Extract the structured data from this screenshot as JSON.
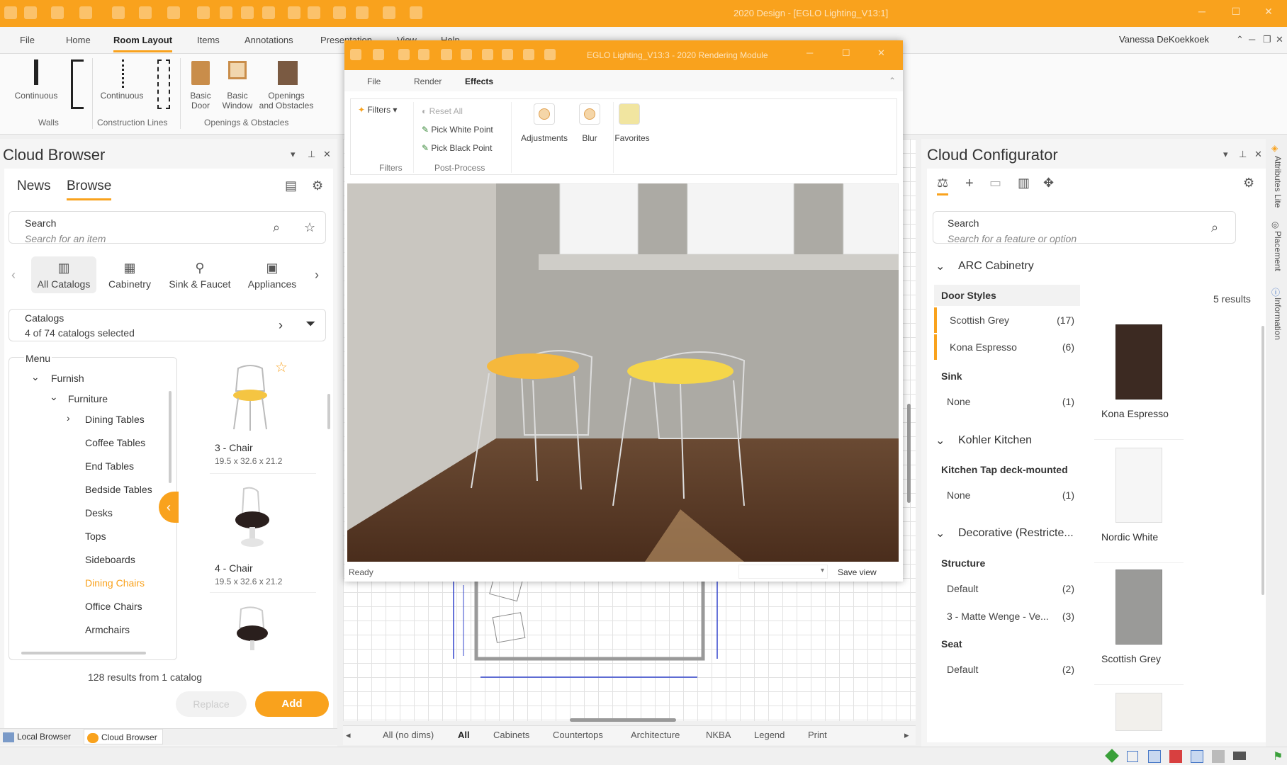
{
  "app": {
    "title": "2020 Design - [EGLO Lighting_V13:1]",
    "user": "Vanessa DeKoekkoek"
  },
  "ribbon_tabs": [
    "File",
    "Home",
    "Room Layout",
    "Items",
    "Annotations",
    "Presentation",
    "View",
    "Help"
  ],
  "ribbon": {
    "walls_continuous": "Continuous",
    "walls_group": "Walls",
    "cl_continuous": "Continuous",
    "cl_group": "Construction Lines",
    "basic_door_1": "Basic",
    "basic_door_2": "Door",
    "basic_window_1": "Basic",
    "basic_window_2": "Window",
    "openings_1": "Openings",
    "openings_2": "and Obstacles",
    "oo_group": "Openings & Obstacles"
  },
  "cloud_browser": {
    "title": "Cloud Browser",
    "tab_news": "News",
    "tab_browse": "Browse",
    "search_label": "Search",
    "search_placeholder": "Search for an item",
    "categories": [
      "All Catalogs",
      "Cabinetry",
      "Sink & Faucet",
      "Appliances"
    ],
    "catalogs_label": "Catalogs",
    "catalogs_value": "4 of 74 catalogs selected",
    "menu_label": "Menu",
    "menu": {
      "furnish": "Furnish",
      "furniture": "Furniture",
      "dining_tables": "Dining Tables",
      "coffee_tables": "Coffee Tables",
      "end_tables": "End Tables",
      "bedside_tables": "Bedside Tables",
      "desks": "Desks",
      "tops": "Tops",
      "sideboards": "Sideboards",
      "dining_chairs": "Dining Chairs",
      "office_chairs": "Office Chairs",
      "armchairs": "Armchairs"
    },
    "products": [
      {
        "name": "3 - Chair",
        "dims": "19.5 x 32.6 x 21.2"
      },
      {
        "name": "4 - Chair",
        "dims": "19.5 x 32.6 x 21.2"
      }
    ],
    "results": "128 results from 1 catalog",
    "replace_label": "Replace",
    "add_label": "Add",
    "bottom_local": "Local Browser",
    "bottom_cloud": "Cloud Browser"
  },
  "render_module": {
    "title": "EGLO Lighting_V13:3 - 2020 Rendering Module",
    "tabs": [
      "File",
      "Render",
      "Effects"
    ],
    "filters": "Filters",
    "reset_all": "Reset All",
    "pick_white": "Pick White Point",
    "pick_black": "Pick Black Point",
    "adjustments": "Adjustments",
    "blur": "Blur",
    "favorites": "Favorites",
    "grp_filters": "Filters",
    "grp_postprocess": "Post-Process",
    "status": "Ready",
    "save_view": "Save view"
  },
  "bottom_tabs": [
    "All (no dims)",
    "All",
    "Cabinets",
    "Countertops",
    "Architecture",
    "NKBA",
    "Legend",
    "Print"
  ],
  "cloud_configurator": {
    "title": "Cloud Configurator",
    "search_label": "Search",
    "search_placeholder": "Search for a feature or option",
    "results": "5 results",
    "arc": "ARC Cabinetry",
    "door_styles": "Door Styles",
    "scottish_grey": "Scottish Grey",
    "scottish_grey_count": "(17)",
    "kona_espresso": "Kona Espresso",
    "kona_espresso_count": "(6)",
    "sink": "Sink",
    "none": "None",
    "one": "(1)",
    "kohler": "Kohler Kitchen",
    "tap": "Kitchen Tap deck-mounted",
    "decorative": "Decorative (Restricte...",
    "structure": "Structure",
    "default": "Default",
    "two": "(2)",
    "matte": "3 - Matte Wenge - Ve...",
    "three": "(3)",
    "seat": "Seat",
    "thumbs": [
      "Kona Espresso",
      "Nordic White",
      "Scottish Grey"
    ],
    "side_attr": "Attributes Lite",
    "side_placement": "Placement",
    "side_info": "Information"
  }
}
